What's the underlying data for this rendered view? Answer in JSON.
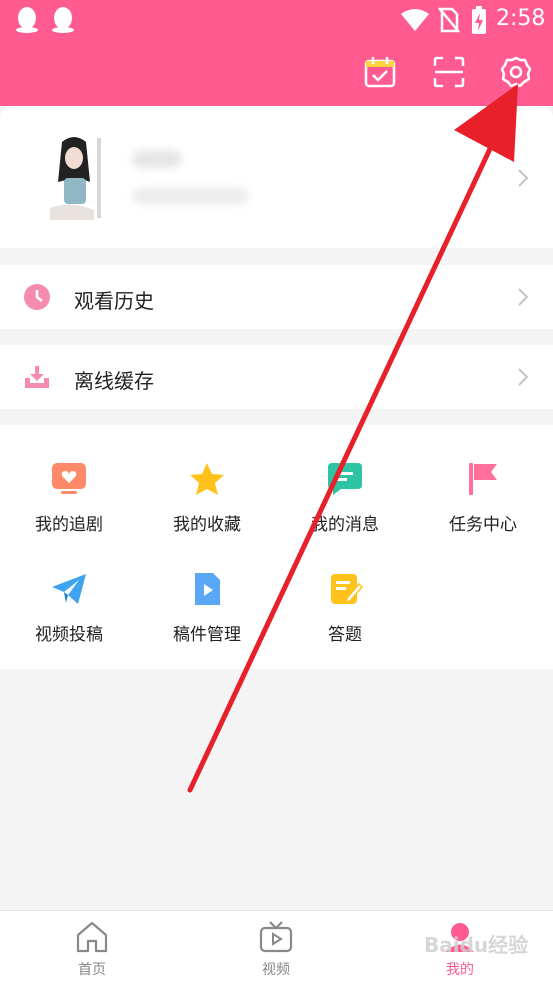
{
  "status_bar": {
    "time": "2:58"
  },
  "menu_rows": [
    {
      "label": "观看历史"
    },
    {
      "label": "离线缓存"
    }
  ],
  "grid": [
    {
      "label": "我的追剧",
      "icon": "tv-heart-icon"
    },
    {
      "label": "我的收藏",
      "icon": "star-icon"
    },
    {
      "label": "我的消息",
      "icon": "message-icon"
    },
    {
      "label": "任务中心",
      "icon": "flag-icon"
    },
    {
      "label": "视频投稿",
      "icon": "paper-plane-icon"
    },
    {
      "label": "稿件管理",
      "icon": "video-file-icon"
    },
    {
      "label": "答题",
      "icon": "quiz-icon"
    }
  ],
  "bottom_nav": [
    {
      "label": "首页",
      "icon": "home-icon"
    },
    {
      "label": "视频",
      "icon": "tv-play-icon"
    },
    {
      "label": "我的",
      "icon": "profile-icon",
      "active": true
    }
  ],
  "watermark": "Baidu经验",
  "colors": {
    "brand": "#ff5b91",
    "arrow": "#e8202a"
  }
}
